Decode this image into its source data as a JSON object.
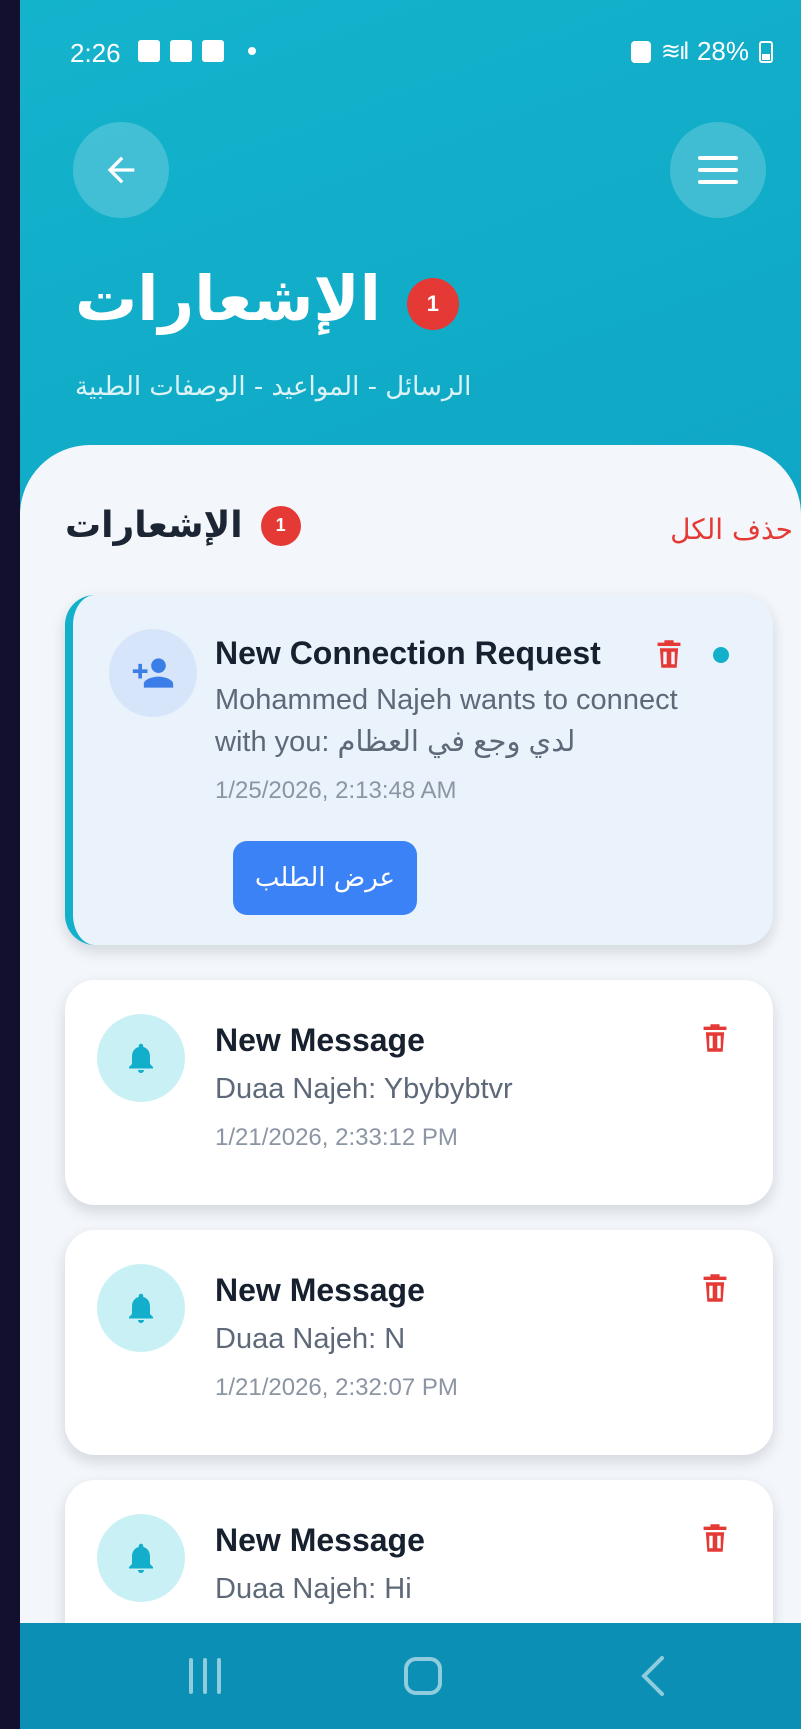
{
  "status_bar": {
    "time": "2:26",
    "battery": "28%"
  },
  "header": {
    "title": "الإشعارات",
    "badge_count": "1",
    "subtitle": "الرسائل - المواعيد - الوصفات الطبية"
  },
  "section": {
    "title": "الإشعارات",
    "badge_count": "1",
    "delete_all_label": "حذف الكل"
  },
  "notifications": [
    {
      "type": "connection",
      "title": "New Connection Request",
      "body_line1": "Mohammed Najeh wants to connect",
      "body_line2": "with you: لدي وجع في العظام",
      "time": "1/25/2026, 2:13:48 AM",
      "action_label": "عرض الطلب",
      "unread": true,
      "icon": "person-add-icon"
    },
    {
      "type": "message",
      "title": "New Message",
      "body": "Duaa Najeh: Ybybybtvr",
      "time": "1/21/2026, 2:33:12 PM",
      "icon": "bell-icon"
    },
    {
      "type": "message",
      "title": "New Message",
      "body": "Duaa Najeh: N",
      "time": "1/21/2026, 2:32:07 PM",
      "icon": "bell-icon"
    },
    {
      "type": "message",
      "title": "New Message",
      "body": "Duaa Najeh: Hi",
      "icon": "bell-icon"
    }
  ],
  "colors": {
    "accent": "#13b0cc",
    "badge": "#e53935",
    "primary_button": "#3b82f6",
    "delete": "#e53935"
  }
}
